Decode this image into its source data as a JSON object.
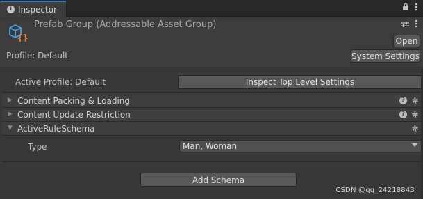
{
  "tab": {
    "title": "Inspector",
    "icon": "info-icon"
  },
  "tabbar_tools": {
    "lock_icon": "lock-icon",
    "menu_icon": "kebab-menu-icon"
  },
  "header": {
    "title": "Prefab Group (Addressable Asset Group)",
    "asset_icon": "addressable-group-icon",
    "open_label": "Open",
    "profile_label": "Profile: Default",
    "system_settings_label": "System Settings"
  },
  "active_profile": {
    "label": "Active Profile: Default",
    "inspect_label": "Inspect Top Level Settings"
  },
  "sections": [
    {
      "title": "Content Packing & Loading",
      "expanded": false,
      "has_help": true
    },
    {
      "title": "Content Update Restriction",
      "expanded": false,
      "has_help": true
    },
    {
      "title": "ActiveRuleSchema",
      "expanded": true,
      "has_help": false
    }
  ],
  "schema_field": {
    "label": "Type",
    "value": "Man, Woman"
  },
  "add_schema_label": "Add Schema",
  "watermark": "CSDN @qq_24218843",
  "colors": {
    "tab_accent": "#3a79bb",
    "icon_blue": "#4a9fe0",
    "icon_orange": "#e8823a"
  }
}
